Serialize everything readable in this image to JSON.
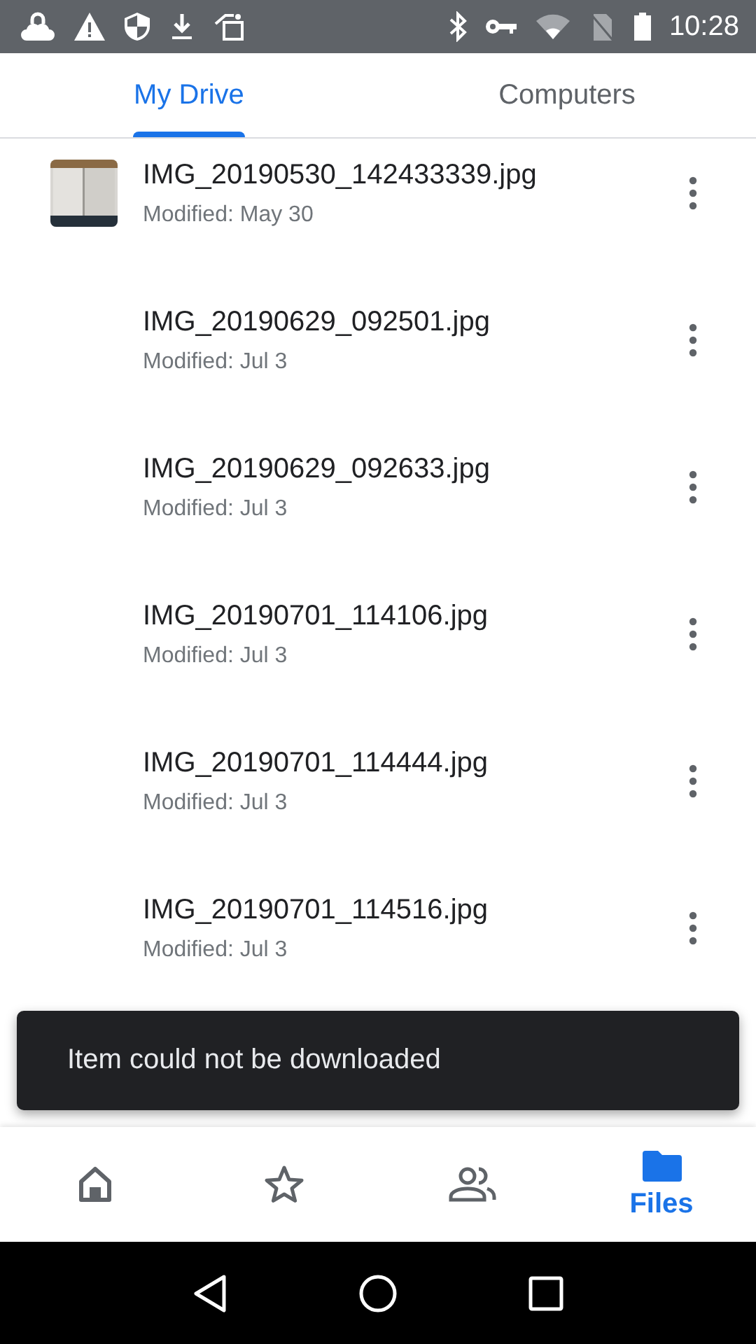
{
  "status_bar": {
    "time": "10:28"
  },
  "tabs": [
    {
      "label": "My Drive",
      "selected": true
    },
    {
      "label": "Computers",
      "selected": false
    }
  ],
  "files": [
    {
      "name": "IMG_20190530_142433339.jpg",
      "modified": "Modified: May 30"
    },
    {
      "name": "IMG_20190629_092501.jpg",
      "modified": "Modified: Jul 3"
    },
    {
      "name": "IMG_20190629_092633.jpg",
      "modified": "Modified: Jul 3"
    },
    {
      "name": "IMG_20190701_114106.jpg",
      "modified": "Modified: Jul 3"
    },
    {
      "name": "IMG_20190701_114444.jpg",
      "modified": "Modified: Jul 3"
    },
    {
      "name": "IMG_20190701_114516.jpg",
      "modified": "Modified: Jul 3"
    }
  ],
  "snackbar": {
    "message": "Item could not be downloaded"
  },
  "bottom_nav": [
    {
      "kind": "home",
      "selected": false
    },
    {
      "kind": "starred",
      "selected": false
    },
    {
      "kind": "shared",
      "selected": false
    },
    {
      "kind": "files",
      "label": "Files",
      "selected": true
    }
  ]
}
